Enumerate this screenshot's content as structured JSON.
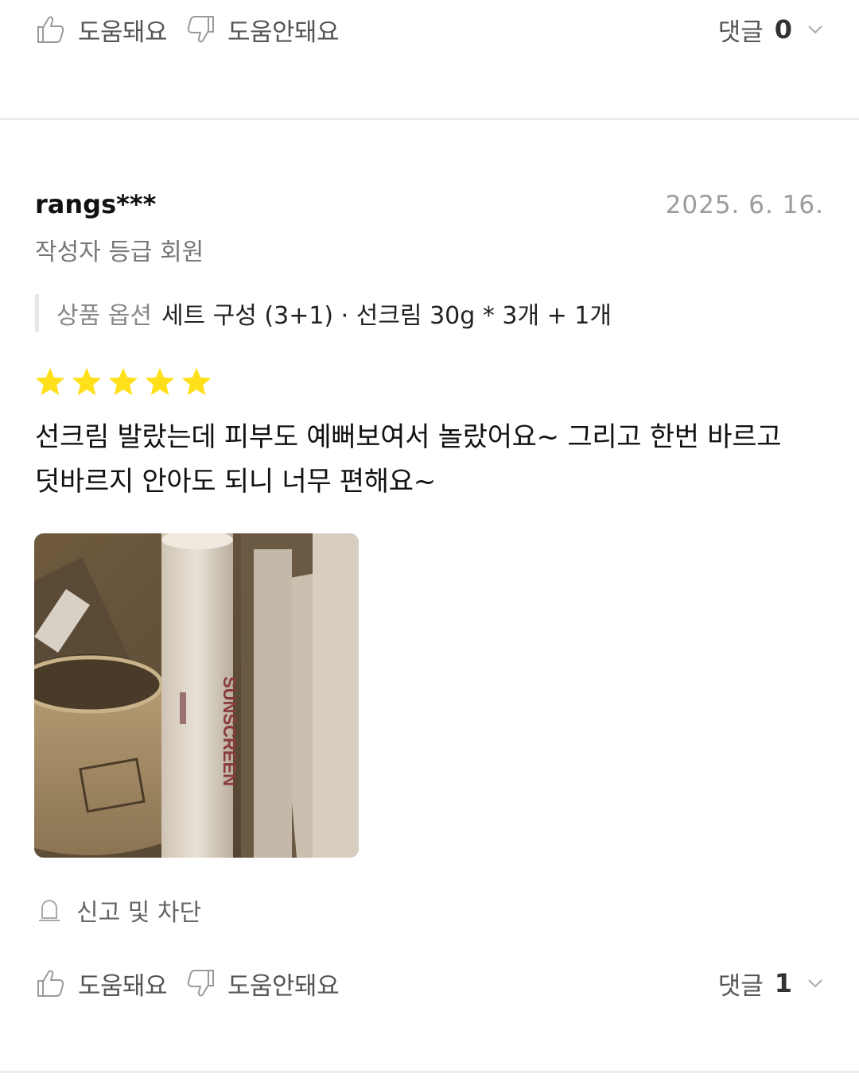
{
  "top_actions": {
    "helpful_label": "도움돼요",
    "not_helpful_label": "도움안돼요",
    "comments_label": "댓글",
    "comments_count": "0"
  },
  "review": {
    "username": "rangs***",
    "date": "2025. 6. 16.",
    "grade": "작성자 등급 회원",
    "option_label": "상품 옵션",
    "option_value": "세트 구성 (3+1) · 선크림 30g * 3개 + 1개",
    "rating": 5,
    "text_line1": "선크림 발랐는데 피부도 예뻐보여서 놀랐어요~ 그리고 한번 바르고",
    "text_line2": "덧바르지 안아도 되니 너무 편해요~",
    "photo_product_text": "SUNSCREEN",
    "report_label": "신고 및 차단"
  },
  "bottom_actions": {
    "helpful_label": "도움돼요",
    "not_helpful_label": "도움안돼요",
    "comments_label": "댓글",
    "comments_count": "1"
  },
  "colors": {
    "star": "#FFE01B",
    "muted_text": "#777777",
    "divider": "#ececec"
  }
}
